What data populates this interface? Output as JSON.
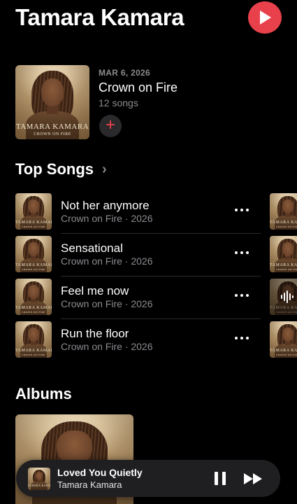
{
  "header": {
    "artist_name": "Tamara Kamara",
    "play_icon": "play-icon",
    "accent_color": "#e8414c"
  },
  "latest_release": {
    "date": "MAR 6, 2026",
    "title": "Crown on Fire",
    "song_count": "12 songs",
    "artwork_artist": "TAMARA KAMARA",
    "artwork_title": "CROWN ON FIRE",
    "add_icon": "plus-icon"
  },
  "top_songs": {
    "title": "Top Songs",
    "chevron": "›",
    "songs": [
      {
        "title": "Not her anymore",
        "subtitle": "Crown on Fire · 2026"
      },
      {
        "title": "Sensational",
        "subtitle": "Crown on Fire · 2026"
      },
      {
        "title": "Feel me now",
        "subtitle": "Crown on Fire · 2026"
      },
      {
        "title": "Run the floor",
        "subtitle": "Crown on Fire · 2026"
      }
    ],
    "more_icon": "ellipsis-icon"
  },
  "albums": {
    "title": "Albums"
  },
  "now_playing": {
    "title": "Loved You Quietly",
    "artist": "Tamara Kamara",
    "pause_icon": "pause-icon",
    "next_icon": "forward-icon"
  }
}
